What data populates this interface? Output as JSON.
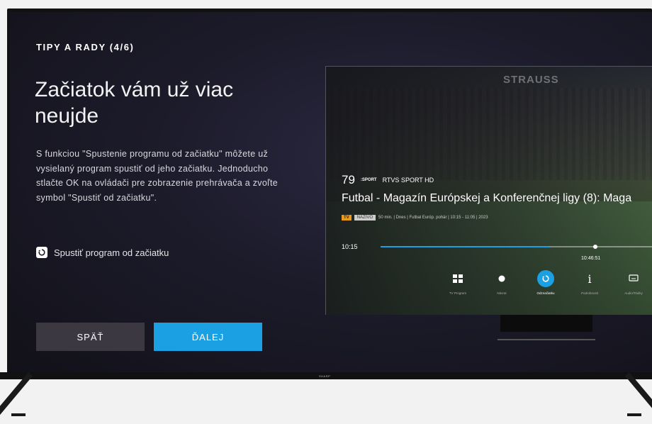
{
  "tips": {
    "kicker": "TIPY A RADY (4/6)",
    "title": "Začiatok vám už viac neujde",
    "description": "S funkciou \"Spustenie programu od začiatku\" môžete už vysielaný program spustiť od jeho začiatku. Jednoducho stlačte OK na ovládači pre zobrazenie prehrávača a zvoľte symbol \"Spustiť od začiatku\".",
    "feature_icon": "restart-icon",
    "feature_label": "Spustiť program od začiatku",
    "back_label": "SPÄŤ",
    "next_label": "ĎALEJ"
  },
  "preview": {
    "sponsor": "STRAUSS",
    "channel_number": "79",
    "channel_logo": ":SPORT",
    "channel_name": "RTVS SPORT HD",
    "program_title": "Futbal - Magazín Európskej a Konferenčnej ligy (8): Maga",
    "tag_tv": "TV",
    "tag_live": "NAŽIVO",
    "meta": "50 min. | Dnes | Futbal Európ. pohár | 10:15 - 11:05 | 2023",
    "time_start": "10:15",
    "time_current": "10:46:51",
    "progress_fraction": 0.62,
    "controls": [
      {
        "label": "TV Program",
        "icon": "grid-icon"
      },
      {
        "label": "Návrat",
        "icon": "dot-icon"
      },
      {
        "label": "Odznačiatku",
        "icon": "restart-icon",
        "active": true
      },
      {
        "label": "Podrobnosti",
        "icon": "info-icon"
      },
      {
        "label": "Audio/Titulky",
        "icon": "subtitles-icon"
      }
    ]
  },
  "device": {
    "brand": "SHARP"
  },
  "colors": {
    "accent": "#1aa0e3",
    "back_button": "#3b3841",
    "screen_bg": "#1c1b2a"
  }
}
